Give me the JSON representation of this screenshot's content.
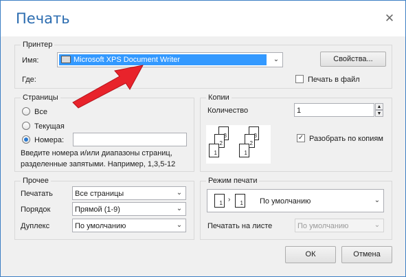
{
  "title": "Печать",
  "printer": {
    "group_title": "Принтер",
    "name_label": "Имя:",
    "name_value": "Microsoft XPS Document Writer",
    "where_label": "Где:",
    "properties_button": "Свойства...",
    "print_to_file_label": "Печать в файл"
  },
  "pages": {
    "group_title": "Страницы",
    "all_label": "Все",
    "current_label": "Текущая",
    "numbers_label": "Номера:",
    "hint": "Введите номера и/или диапазоны страниц, разделенные запятыми. Например, 1,3,5-12"
  },
  "copies": {
    "group_title": "Копии",
    "count_label": "Количество",
    "count_value": "1",
    "collate_label": "Разобрать по копиям"
  },
  "other": {
    "group_title": "Прочее",
    "print_label": "Печатать",
    "print_value": "Все страницы",
    "order_label": "Порядок",
    "order_value": "Прямой (1-9)",
    "duplex_label": "Дуплекс",
    "duplex_value": "По умолчанию"
  },
  "print_mode": {
    "group_title": "Режим печати",
    "mode_value": "По умолчанию",
    "per_sheet_label": "Печатать на листе",
    "per_sheet_value": "По умолчанию"
  },
  "buttons": {
    "ok": "ОК",
    "cancel": "Отмена"
  },
  "colors": {
    "title": "#2b6cb0",
    "selection": "#3399ff",
    "arrow": "#e8232b"
  }
}
